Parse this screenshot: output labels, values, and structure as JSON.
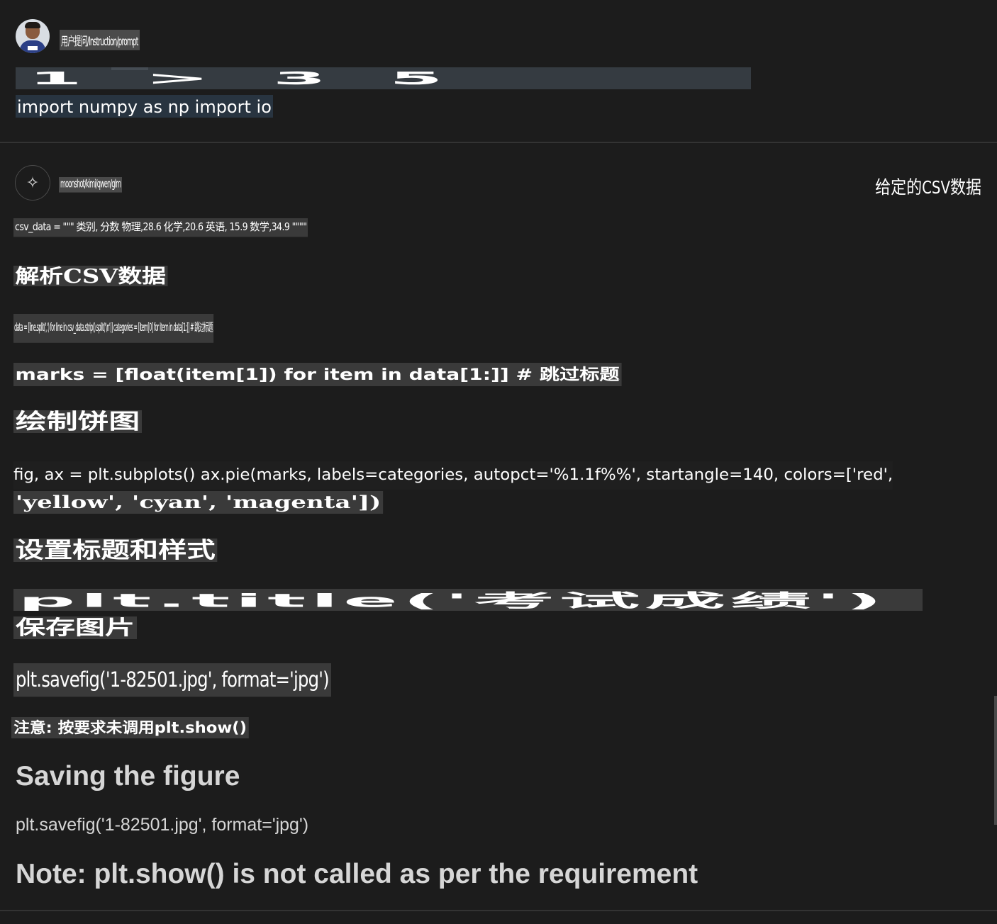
{
  "user": {
    "name": "用户提问/Instruction/prompt",
    "stretched_text": "1 > 3 5",
    "code": "import numpy as np import io"
  },
  "assistant": {
    "name": "moonshot/kimi/qwen/glm",
    "top_right": "给定的CSV数据",
    "csv_line": "csv_data = \"\"\" 类别, 分数 物理,28.6 化学,20.6 英语, 15.9 数学,34.9 \"\"\"\"",
    "heading_parse": "解析CSV数据",
    "data_line": "data = [line.split(',') for line in csv_data.strip().split('\\n')] categories = [item[0] for item in data[1:]] # 跳过标题",
    "marks_line": "marks = [float(item[1]) for item in data[1:]] # 跳过标题",
    "heading_pie": "绘制饼图",
    "pie_line_1": "fig, ax = plt.subplots() ax.pie(marks, labels=categories, autopct='%1.1f%%', startangle=140, colors=['red',",
    "pie_line_2": "'yellow', 'cyan', 'magenta'])",
    "heading_style": "设置标题和样式",
    "title_line": "plt.title('考试成绩')",
    "heading_save": "保存图片",
    "savefig_cn": "plt.savefig('1-82501.jpg', format='jpg')",
    "note_cn": "注意: 按要求未调用plt.show()",
    "en_heading_saving": "Saving the figure",
    "en_savefig": "plt.savefig('1-82501.jpg', format='jpg')",
    "en_note": "Note: plt.show() is not called as per the requirement"
  },
  "icons": {
    "bot": "sparkle-icon",
    "user": "user-avatar"
  },
  "colors": {
    "background": "#1c1c1c",
    "highlight": "#3a3a3a",
    "code_highlight": "#283440",
    "text_muted": "#d6d6d6"
  }
}
